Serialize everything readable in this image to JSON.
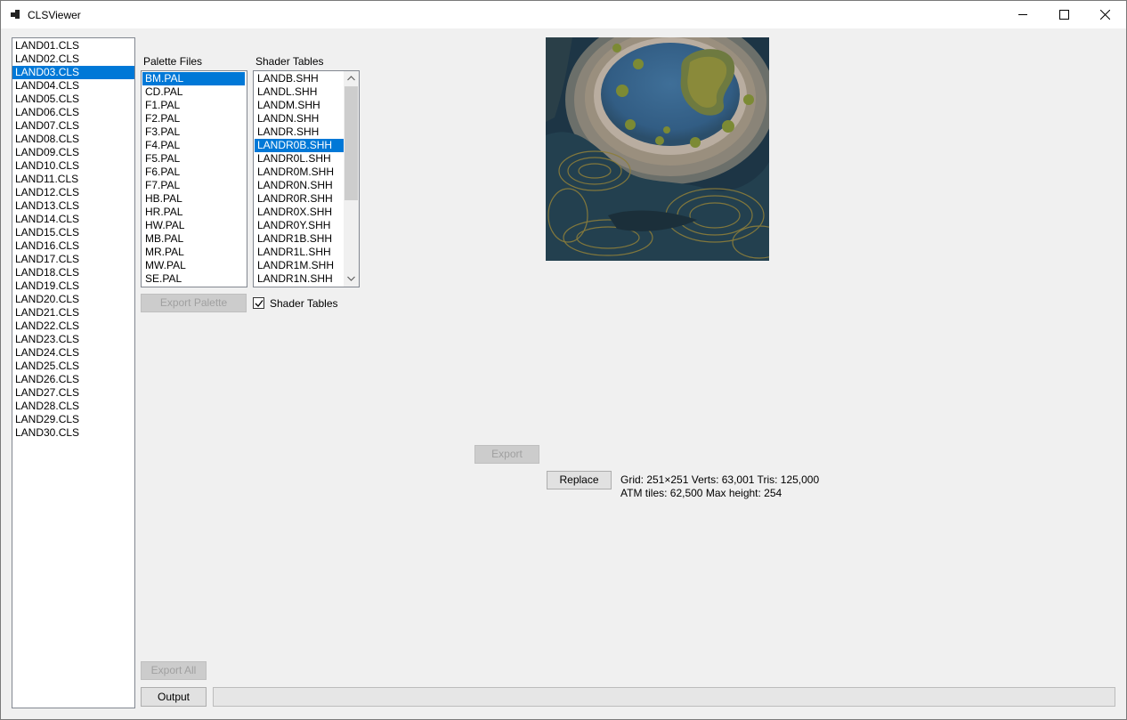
{
  "window": {
    "title": "CLSViewer"
  },
  "cls_files": {
    "items": [
      "LAND01.CLS",
      "LAND02.CLS",
      "LAND03.CLS",
      "LAND04.CLS",
      "LAND05.CLS",
      "LAND06.CLS",
      "LAND07.CLS",
      "LAND08.CLS",
      "LAND09.CLS",
      "LAND10.CLS",
      "LAND11.CLS",
      "LAND12.CLS",
      "LAND13.CLS",
      "LAND14.CLS",
      "LAND15.CLS",
      "LAND16.CLS",
      "LAND17.CLS",
      "LAND18.CLS",
      "LAND19.CLS",
      "LAND20.CLS",
      "LAND21.CLS",
      "LAND22.CLS",
      "LAND23.CLS",
      "LAND24.CLS",
      "LAND25.CLS",
      "LAND26.CLS",
      "LAND27.CLS",
      "LAND28.CLS",
      "LAND29.CLS",
      "LAND30.CLS"
    ],
    "selected": "LAND03.CLS"
  },
  "palette": {
    "label": "Palette Files",
    "items": [
      "BM.PAL",
      "CD.PAL",
      "F1.PAL",
      "F2.PAL",
      "F3.PAL",
      "F4.PAL",
      "F5.PAL",
      "F6.PAL",
      "F7.PAL",
      "HB.PAL",
      "HR.PAL",
      "HW.PAL",
      "MB.PAL",
      "MR.PAL",
      "MW.PAL",
      "SE.PAL"
    ],
    "selected": "BM.PAL",
    "export_label": "Export Palette"
  },
  "shader": {
    "label": "Shader Tables",
    "items": [
      "LANDB.SHH",
      "LANDL.SHH",
      "LANDM.SHH",
      "LANDN.SHH",
      "LANDR.SHH",
      "LANDR0B.SHH",
      "LANDR0L.SHH",
      "LANDR0M.SHH",
      "LANDR0N.SHH",
      "LANDR0R.SHH",
      "LANDR0X.SHH",
      "LANDR0Y.SHH",
      "LANDR1B.SHH",
      "LANDR1L.SHH",
      "LANDR1M.SHH",
      "LANDR1N.SHH"
    ],
    "selected": "LANDR0B.SHH",
    "checkbox_label": "Shader Tables",
    "checkbox_checked": true
  },
  "actions": {
    "export_label": "Export",
    "replace_label": "Replace",
    "export_all_label": "Export All",
    "output_label": "Output"
  },
  "stats": {
    "line1": "Grid: 251×251  Verts: 63,001  Tris: 125,000",
    "line2": "ATM tiles: 62,500  Max height: 254"
  },
  "progress": {
    "value": 0
  }
}
